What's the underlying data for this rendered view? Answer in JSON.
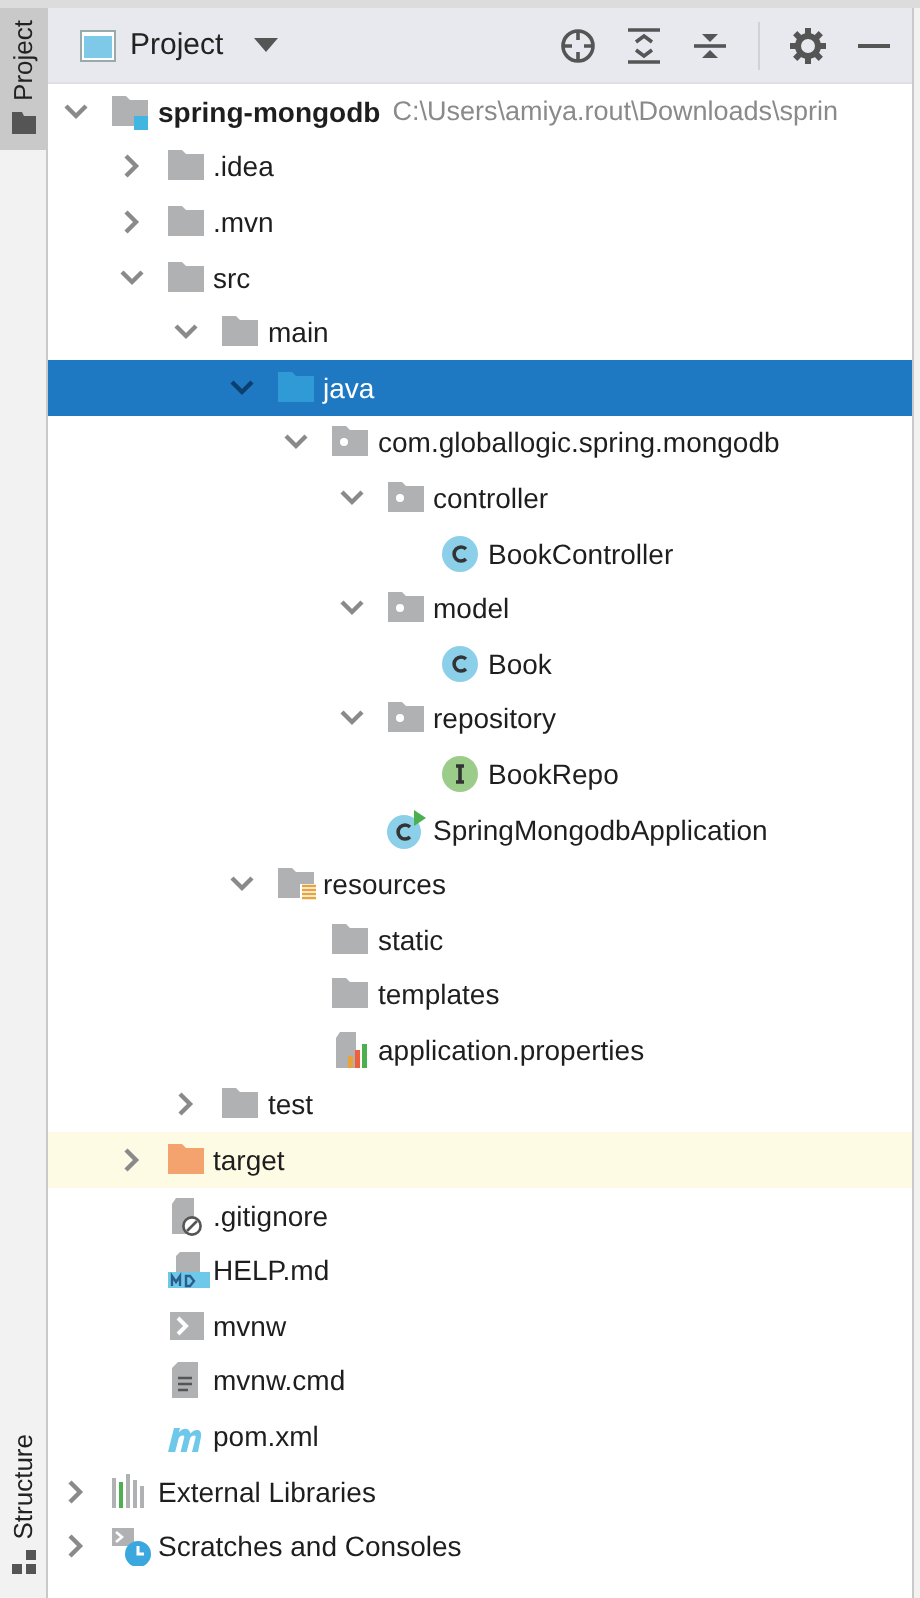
{
  "side_tabs": [
    {
      "label": "Project",
      "selected": true,
      "kind": "project"
    },
    {
      "label": "Structure",
      "selected": false,
      "kind": "structure"
    }
  ],
  "toolbar": {
    "view": "Project"
  },
  "tree": {
    "items": [
      {
        "label": "spring-mongodb",
        "path": "C:\\Users\\amiya.rout\\Downloads\\sprin",
        "kind": "module",
        "expanded": true,
        "selected": false,
        "highlighted": false,
        "children": [
          {
            "label": ".idea",
            "kind": "folder",
            "expanded": false,
            "selected": false,
            "highlighted": false
          },
          {
            "label": ".mvn",
            "kind": "folder",
            "expanded": false,
            "selected": false,
            "highlighted": false
          },
          {
            "label": "src",
            "kind": "folder",
            "expanded": true,
            "selected": false,
            "highlighted": false,
            "children": [
              {
                "label": "main",
                "kind": "folder",
                "expanded": true,
                "selected": false,
                "highlighted": false,
                "children": [
                  {
                    "label": "java",
                    "kind": "source-root",
                    "expanded": true,
                    "selected": true,
                    "highlighted": false,
                    "children": [
                      {
                        "label": "com.globallogic.spring.mongodb",
                        "kind": "package",
                        "expanded": true,
                        "selected": false,
                        "highlighted": false,
                        "children": [
                          {
                            "label": "controller",
                            "kind": "package",
                            "expanded": true,
                            "selected": false,
                            "highlighted": false,
                            "children": [
                              {
                                "label": "BookController",
                                "kind": "class",
                                "selected": false,
                                "highlighted": false
                              }
                            ]
                          },
                          {
                            "label": "model",
                            "kind": "package",
                            "expanded": true,
                            "selected": false,
                            "highlighted": false,
                            "children": [
                              {
                                "label": "Book",
                                "kind": "class",
                                "selected": false,
                                "highlighted": false
                              }
                            ]
                          },
                          {
                            "label": "repository",
                            "kind": "package",
                            "expanded": true,
                            "selected": false,
                            "highlighted": false,
                            "children": [
                              {
                                "label": "BookRepo",
                                "kind": "interface",
                                "selected": false,
                                "highlighted": false
                              }
                            ]
                          },
                          {
                            "label": "SpringMongodbApplication",
                            "kind": "app-class",
                            "selected": false,
                            "highlighted": false
                          }
                        ]
                      }
                    ]
                  },
                  {
                    "label": "resources",
                    "kind": "resources-root",
                    "expanded": true,
                    "selected": false,
                    "highlighted": false,
                    "children": [
                      {
                        "label": "static",
                        "kind": "folder",
                        "selected": false,
                        "highlighted": false
                      },
                      {
                        "label": "templates",
                        "kind": "folder",
                        "selected": false,
                        "highlighted": false
                      },
                      {
                        "label": "application.properties",
                        "kind": "properties",
                        "selected": false,
                        "highlighted": false
                      }
                    ]
                  }
                ]
              },
              {
                "label": "test",
                "kind": "folder",
                "expanded": false,
                "selected": false,
                "highlighted": false
              }
            ]
          },
          {
            "label": "target",
            "kind": "excluded-folder",
            "expanded": false,
            "selected": false,
            "highlighted": true
          },
          {
            "label": ".gitignore",
            "kind": "ignore-file",
            "selected": false,
            "highlighted": false
          },
          {
            "label": "HELP.md",
            "kind": "markdown",
            "selected": false,
            "highlighted": false
          },
          {
            "label": "mvnw",
            "kind": "shell",
            "selected": false,
            "highlighted": false
          },
          {
            "label": "mvnw.cmd",
            "kind": "text-file",
            "selected": false,
            "highlighted": false
          },
          {
            "label": "pom.xml",
            "kind": "maven",
            "selected": false,
            "highlighted": false
          }
        ]
      },
      {
        "label": "External Libraries",
        "kind": "libraries",
        "expanded": false,
        "selected": false,
        "highlighted": false
      },
      {
        "label": "Scratches and Consoles",
        "kind": "scratches",
        "expanded": false,
        "selected": false,
        "highlighted": false
      }
    ]
  }
}
